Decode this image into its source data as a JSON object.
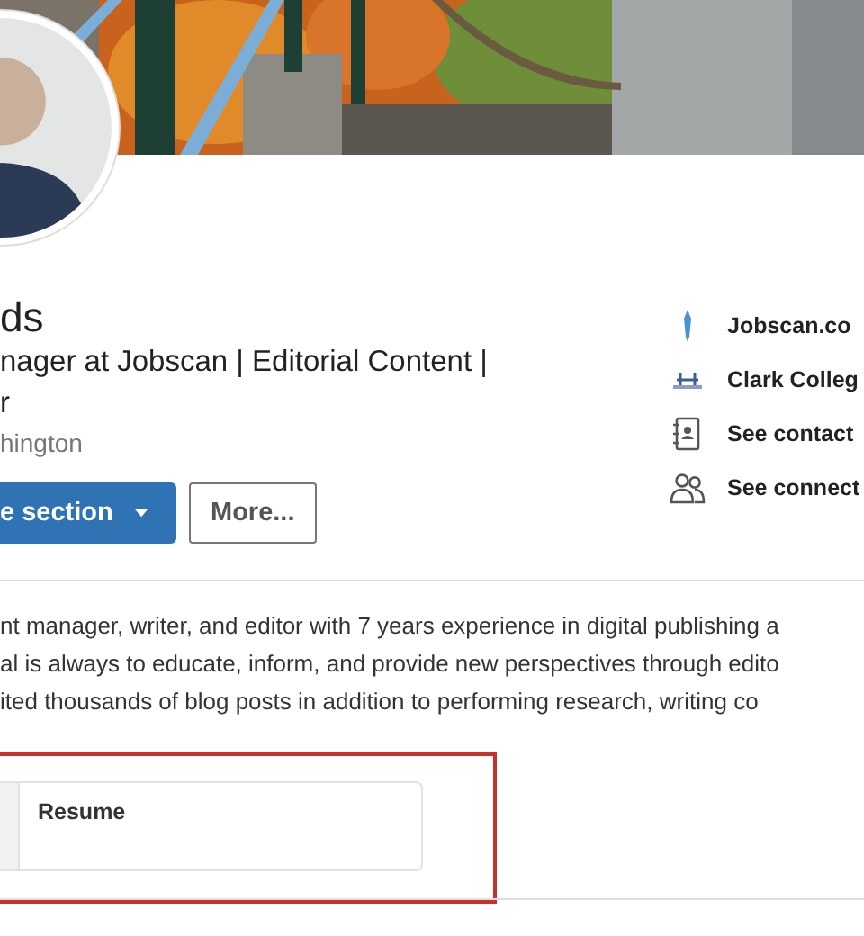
{
  "profile": {
    "name": "ds",
    "headline": [
      "nager at Jobscan | Editorial Content |",
      "r"
    ],
    "location": "hington",
    "buttons": [
      {
        "label": "e section",
        "kind": "primary",
        "dropdown": true
      },
      {
        "label": "More...",
        "kind": "secondary",
        "dropdown": false
      }
    ]
  },
  "links": [
    {
      "label": "Jobscan.co",
      "kind": "company"
    },
    {
      "label": "Clark Colleg",
      "kind": "school"
    },
    {
      "label": "See contact",
      "kind": "contact"
    },
    {
      "label": "See connect",
      "kind": "connections"
    }
  ],
  "about": [
    "nt manager, writer, and editor with 7 years experience in digital publishing a",
    "al is always to educate, inform, and provide new perspectives through edito",
    "ited thousands of blog posts in addition to performing research, writing co"
  ],
  "featured": {
    "highlighted": true,
    "items": [
      {
        "title": "Resume"
      }
    ]
  }
}
